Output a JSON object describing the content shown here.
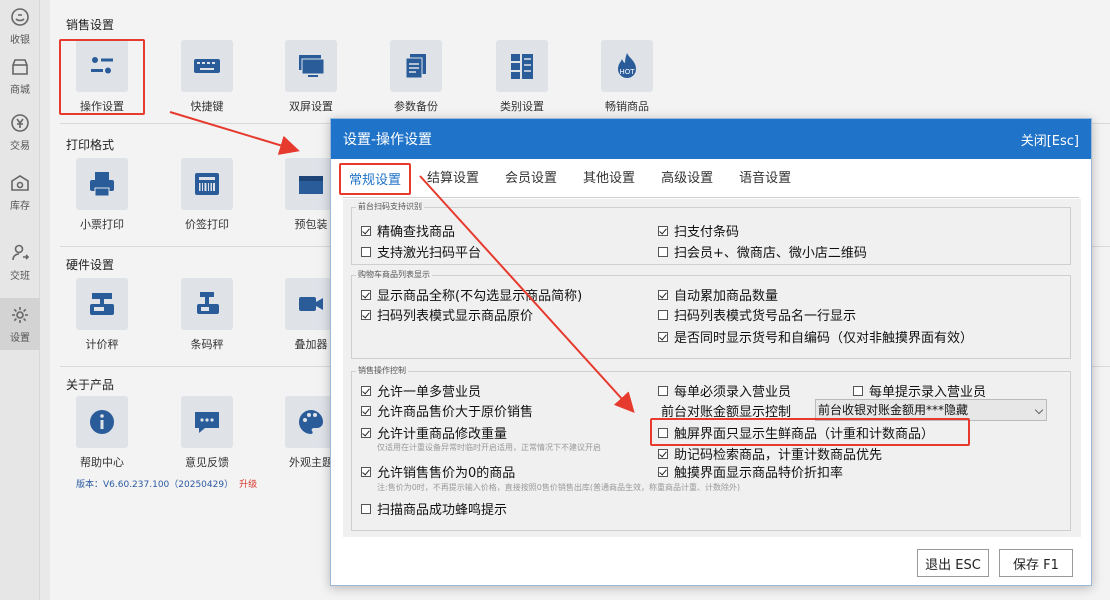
{
  "nav": [
    {
      "label": "收银",
      "icon": "cashier-icon"
    },
    {
      "label": "商城",
      "icon": "store-icon"
    },
    {
      "label": "交易",
      "icon": "yuan-icon"
    },
    {
      "label": "库存",
      "icon": "warehouse-icon"
    },
    {
      "label": "交班",
      "icon": "shift-icon"
    },
    {
      "label": "设置",
      "icon": "gear-icon"
    }
  ],
  "sections": {
    "sales": "销售设置",
    "print": "打印格式",
    "hardware": "硬件设置",
    "about": "关于产品"
  },
  "tiles": {
    "sales": [
      "操作设置",
      "快捷键",
      "双屏设置",
      "参数备份",
      "类别设置",
      "畅销商品"
    ],
    "print": [
      "小票打印",
      "价签打印",
      "预包装"
    ],
    "hardware": [
      "计价秤",
      "条码秤",
      "叠加器"
    ],
    "about": [
      "帮助中心",
      "意见反馈",
      "外观主题"
    ]
  },
  "hot_badge": "HOT",
  "version": {
    "text": "版本：V6.60.237.100（20250429）",
    "upgrade": "升级"
  },
  "dialog": {
    "title": "设置-操作设置",
    "close": "关闭[Esc]",
    "tabs": [
      "常规设置",
      "结算设置",
      "会员设置",
      "其他设置",
      "高级设置",
      "语音设置"
    ],
    "groups": {
      "scan": "前台扫码支持识别",
      "cart": "购物车商品列表显示",
      "sales": "销售操作控制"
    },
    "scan_options": [
      {
        "label": "精确查找商品",
        "checked": true
      },
      {
        "label": "扫支付条码",
        "checked": true
      },
      {
        "label": "支持激光扫码平台",
        "checked": false
      },
      {
        "label": "扫会员+、微商店、微小店二维码",
        "checked": false
      }
    ],
    "cart_options": [
      {
        "label": "显示商品全称(不勾选显示商品简称)",
        "checked": true
      },
      {
        "label": "自动累加商品数量",
        "checked": true
      },
      {
        "label": "扫码列表模式显示商品原价",
        "checked": true
      },
      {
        "label": "扫码列表模式货号品名一行显示",
        "checked": false
      },
      {
        "label": "是否同时显示货号和自编码（仅对非触摸界面有效）",
        "checked": true
      }
    ],
    "sales_options": {
      "multi_clerk": {
        "label": "允许一单多营业员",
        "checked": true
      },
      "must_clerk": {
        "label": "每单必须录入营业员",
        "checked": false
      },
      "prompt_clerk": {
        "label": "每单提示录入营业员",
        "checked": false
      },
      "price_above": {
        "label": "允许商品售价大于原价销售",
        "checked": true
      },
      "recon_label": "前台对账金额显示控制",
      "recon_select": "前台收银对账金额用***隐藏",
      "weigh_edit": {
        "label": "允许计重商品修改重量",
        "checked": true
      },
      "weigh_note": "仅适用在计重设备异常时临时开启适用，正常情况下不建议开启",
      "fresh_only": {
        "label": "触屏界面只显示生鲜商品（计重和计数商品）",
        "checked": false
      },
      "mnemonic": {
        "label": "助记码检索商品，计重计数商品优先",
        "checked": true
      },
      "zero_price": {
        "label": "允许销售售价为0的商品",
        "checked": true
      },
      "discount": {
        "label": "触摸界面显示商品特价折扣率",
        "checked": true
      },
      "zero_note": "注:售价为0时，不再提示输入价格，直接按照0售价销售出库(普通商品生效，称重商品计重、计数除外)",
      "beep": {
        "label": "扫描商品成功蜂鸣提示",
        "checked": false
      }
    },
    "buttons": {
      "exit": "退出 ESC",
      "save": "保存 F1"
    }
  },
  "colors": {
    "accent": "#1f73c8",
    "annotation": "#e63a2e"
  }
}
